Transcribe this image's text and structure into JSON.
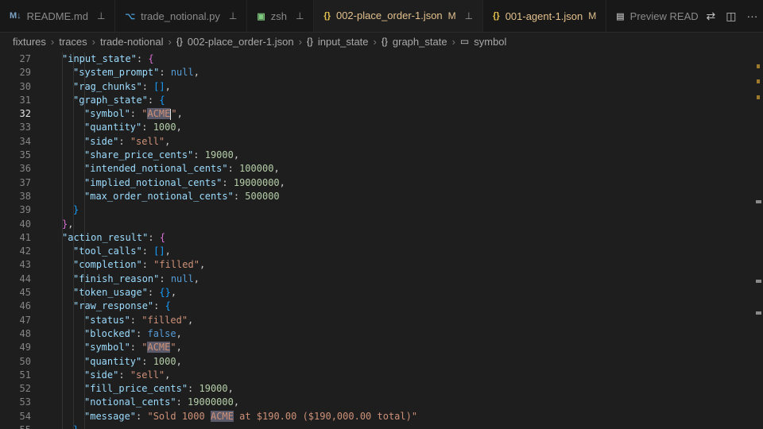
{
  "tabs": [
    {
      "icon": "M↓",
      "label": "README.md",
      "pinned": true,
      "active": false
    },
    {
      "icon": "⌥",
      "label": "trade_notional.py",
      "pinned": true,
      "active": false
    },
    {
      "icon": "▣",
      "label": "zsh",
      "pinned": true,
      "active": false
    },
    {
      "icon": "{}",
      "label": "002-place_order-1.json",
      "modified": "M",
      "pinned": true,
      "active": true
    },
    {
      "icon": "{}",
      "label": "001-agent-1.json",
      "modified": "M",
      "pinned": false,
      "active": false
    },
    {
      "icon": "▤",
      "label": "Preview READ",
      "pinned": false,
      "active": false
    }
  ],
  "breadcrumb": {
    "items": [
      "fixtures",
      "traces",
      "trade-notional"
    ],
    "file": "002-place_order-1.json",
    "path": [
      "input_state",
      "graph_state"
    ],
    "symbol": "symbol"
  },
  "editor": {
    "current_line": 32,
    "lines": [
      {
        "n": "27",
        "indent": 1,
        "parts": [
          [
            "k",
            "\"input_state\""
          ],
          [
            "p",
            ": "
          ],
          [
            "b2",
            "{"
          ]
        ]
      },
      {
        "n": "29",
        "indent": 2,
        "parts": [
          [
            "k",
            "\"system_prompt\""
          ],
          [
            "p",
            ": "
          ],
          [
            "c",
            "null"
          ],
          [
            "p",
            ","
          ]
        ]
      },
      {
        "n": "30",
        "indent": 2,
        "parts": [
          [
            "k",
            "\"rag_chunks\""
          ],
          [
            "p",
            ": "
          ],
          [
            "b3",
            "[]"
          ],
          [
            "p",
            ","
          ]
        ]
      },
      {
        "n": "31",
        "indent": 2,
        "parts": [
          [
            "k",
            "\"graph_state\""
          ],
          [
            "p",
            ": "
          ],
          [
            "b3",
            "{"
          ]
        ]
      },
      {
        "n": "32",
        "indent": 3,
        "parts": [
          [
            "k",
            "\"symbol\""
          ],
          [
            "p",
            ": "
          ],
          [
            "s",
            "\""
          ],
          [
            "hl",
            "ACME"
          ],
          [
            "cursor",
            ""
          ],
          [
            "s",
            "\""
          ],
          [
            "p",
            ","
          ]
        ]
      },
      {
        "n": "33",
        "indent": 3,
        "parts": [
          [
            "k",
            "\"quantity\""
          ],
          [
            "p",
            ": "
          ],
          [
            "n",
            "1000"
          ],
          [
            "p",
            ","
          ]
        ]
      },
      {
        "n": "34",
        "indent": 3,
        "parts": [
          [
            "k",
            "\"side\""
          ],
          [
            "p",
            ": "
          ],
          [
            "s",
            "\"sell\""
          ],
          [
            "p",
            ","
          ]
        ]
      },
      {
        "n": "35",
        "indent": 3,
        "parts": [
          [
            "k",
            "\"share_price_cents\""
          ],
          [
            "p",
            ": "
          ],
          [
            "n",
            "19000"
          ],
          [
            "p",
            ","
          ]
        ]
      },
      {
        "n": "36",
        "indent": 3,
        "parts": [
          [
            "k",
            "\"intended_notional_cents\""
          ],
          [
            "p",
            ": "
          ],
          [
            "n",
            "100000"
          ],
          [
            "p",
            ","
          ]
        ]
      },
      {
        "n": "37",
        "indent": 3,
        "parts": [
          [
            "k",
            "\"implied_notional_cents\""
          ],
          [
            "p",
            ": "
          ],
          [
            "n",
            "19000000"
          ],
          [
            "p",
            ","
          ]
        ]
      },
      {
        "n": "38",
        "indent": 3,
        "parts": [
          [
            "k",
            "\"max_order_notional_cents\""
          ],
          [
            "p",
            ": "
          ],
          [
            "n",
            "500000"
          ]
        ]
      },
      {
        "n": "39",
        "indent": 2,
        "parts": [
          [
            "b3",
            "}"
          ]
        ]
      },
      {
        "n": "40",
        "indent": 1,
        "parts": [
          [
            "b2",
            "}"
          ],
          [
            "p",
            ","
          ]
        ]
      },
      {
        "n": "41",
        "indent": 1,
        "parts": [
          [
            "k",
            "\"action_result\""
          ],
          [
            "p",
            ": "
          ],
          [
            "b2",
            "{"
          ]
        ]
      },
      {
        "n": "42",
        "indent": 2,
        "parts": [
          [
            "k",
            "\"tool_calls\""
          ],
          [
            "p",
            ": "
          ],
          [
            "b3",
            "[]"
          ],
          [
            "p",
            ","
          ]
        ]
      },
      {
        "n": "43",
        "indent": 2,
        "parts": [
          [
            "k",
            "\"completion\""
          ],
          [
            "p",
            ": "
          ],
          [
            "s",
            "\"filled\""
          ],
          [
            "p",
            ","
          ]
        ]
      },
      {
        "n": "44",
        "indent": 2,
        "parts": [
          [
            "k",
            "\"finish_reason\""
          ],
          [
            "p",
            ": "
          ],
          [
            "c",
            "null"
          ],
          [
            "p",
            ","
          ]
        ]
      },
      {
        "n": "45",
        "indent": 2,
        "parts": [
          [
            "k",
            "\"token_usage\""
          ],
          [
            "p",
            ": "
          ],
          [
            "b3",
            "{}"
          ],
          [
            "p",
            ","
          ]
        ]
      },
      {
        "n": "46",
        "indent": 2,
        "parts": [
          [
            "k",
            "\"raw_response\""
          ],
          [
            "p",
            ": "
          ],
          [
            "b3",
            "{"
          ]
        ]
      },
      {
        "n": "47",
        "indent": 3,
        "parts": [
          [
            "k",
            "\"status\""
          ],
          [
            "p",
            ": "
          ],
          [
            "s",
            "\"filled\""
          ],
          [
            "p",
            ","
          ]
        ]
      },
      {
        "n": "48",
        "indent": 3,
        "parts": [
          [
            "k",
            "\"blocked\""
          ],
          [
            "p",
            ": "
          ],
          [
            "c",
            "false"
          ],
          [
            "p",
            ","
          ]
        ]
      },
      {
        "n": "49",
        "indent": 3,
        "parts": [
          [
            "k",
            "\"symbol\""
          ],
          [
            "p",
            ": "
          ],
          [
            "s",
            "\""
          ],
          [
            "hl",
            "ACME"
          ],
          [
            "s",
            "\""
          ],
          [
            "p",
            ","
          ]
        ]
      },
      {
        "n": "50",
        "indent": 3,
        "parts": [
          [
            "k",
            "\"quantity\""
          ],
          [
            "p",
            ": "
          ],
          [
            "n",
            "1000"
          ],
          [
            "p",
            ","
          ]
        ]
      },
      {
        "n": "51",
        "indent": 3,
        "parts": [
          [
            "k",
            "\"side\""
          ],
          [
            "p",
            ": "
          ],
          [
            "s",
            "\"sell\""
          ],
          [
            "p",
            ","
          ]
        ]
      },
      {
        "n": "52",
        "indent": 3,
        "parts": [
          [
            "k",
            "\"fill_price_cents\""
          ],
          [
            "p",
            ": "
          ],
          [
            "n",
            "19000"
          ],
          [
            "p",
            ","
          ]
        ]
      },
      {
        "n": "53",
        "indent": 3,
        "parts": [
          [
            "k",
            "\"notional_cents\""
          ],
          [
            "p",
            ": "
          ],
          [
            "n",
            "19000000"
          ],
          [
            "p",
            ","
          ]
        ]
      },
      {
        "n": "54",
        "indent": 3,
        "parts": [
          [
            "k",
            "\"message\""
          ],
          [
            "p",
            ": "
          ],
          [
            "s",
            "\"Sold 1000 "
          ],
          [
            "hl",
            "ACME"
          ],
          [
            "s",
            " at $190.00 ($190,000.00 total)\""
          ]
        ]
      },
      {
        "n": "55",
        "indent": 2,
        "parts": [
          [
            "b3",
            "}"
          ]
        ]
      }
    ]
  },
  "colors": {
    "key": "#9cdcfe",
    "string": "#ce9178",
    "number": "#b5cea8",
    "constant": "#569cd6",
    "modified": "#e2c08d",
    "background": "#1e1e1e"
  },
  "icons": {
    "pin": "pin-icon",
    "json": "json-braces-icon",
    "python": "python-icon",
    "terminal": "terminal-icon",
    "markdown": "markdown-icon",
    "preview": "preview-icon",
    "compare": "git-compare-icon",
    "split": "split-editor-icon",
    "more": "more-actions-icon"
  }
}
